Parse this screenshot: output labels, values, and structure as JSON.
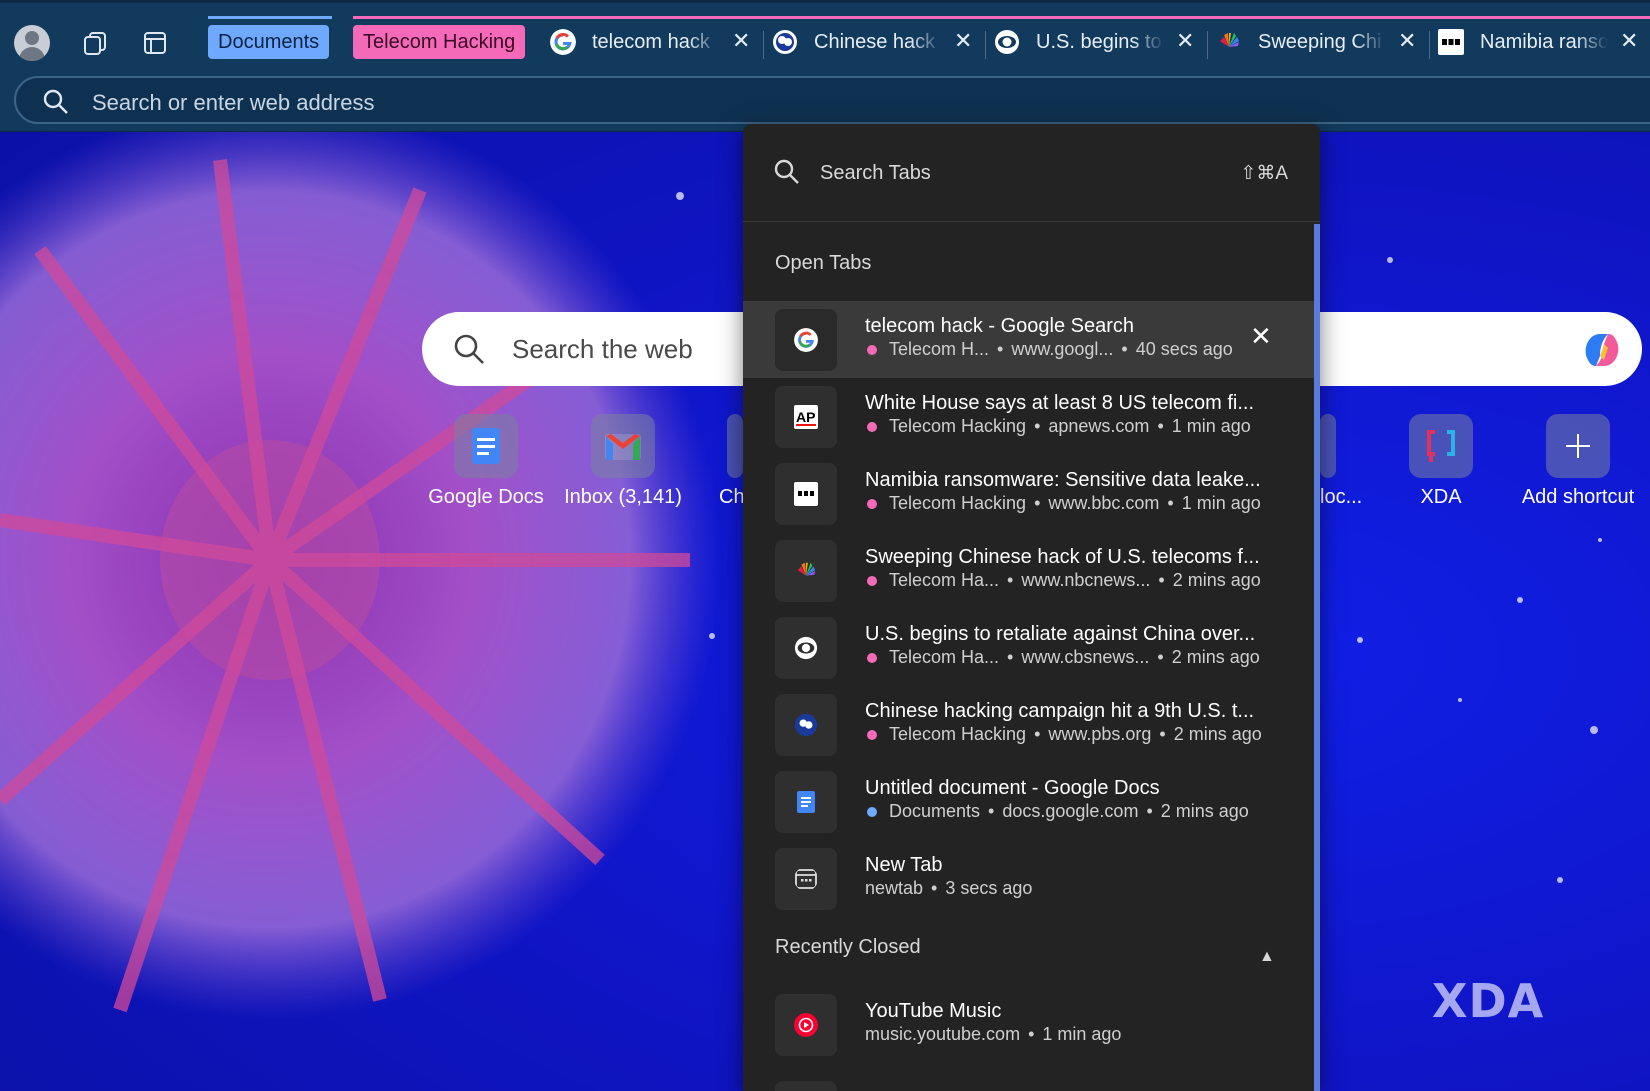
{
  "colors": {
    "tabstrip": "#123a5c",
    "docs_group": "#6ea8ff",
    "telecom_group": "#f46ab8",
    "popup_bg": "#232323",
    "desktop_bg": "#1420b8"
  },
  "tab_groups": [
    {
      "label": "Documents",
      "color": "#6ea8ff"
    },
    {
      "label": "Telecom Hacking",
      "color": "#f46ab8"
    }
  ],
  "tabs": [
    {
      "title": "telecom hack",
      "icon": "google-icon"
    },
    {
      "title": "Chinese hack",
      "icon": "pbs-icon"
    },
    {
      "title": "U.S. begins to",
      "icon": "cbs-icon"
    },
    {
      "title": "Sweeping Chi",
      "icon": "nbc-icon"
    },
    {
      "title": "Namibia ranso",
      "icon": "bbc-icon"
    }
  ],
  "addressbar": {
    "placeholder": "Search or enter web address"
  },
  "newtab": {
    "search_placeholder": "Search the web",
    "shortcuts": [
      {
        "label": "Google Docs",
        "icon": "google-docs-icon"
      },
      {
        "label": "Inbox (3,141)",
        "icon": "gmail-icon"
      },
      {
        "label": "Ch",
        "icon": "partial-shortcut-icon"
      },
      {
        "label": "loc...",
        "icon": "partial-shortcut-icon"
      },
      {
        "label": "XDA",
        "icon": "xda-icon"
      },
      {
        "label": "Add shortcut",
        "icon": "plus-icon"
      }
    ],
    "watermark": "XDA"
  },
  "tab_search": {
    "placeholder": "Search Tabs",
    "shortcut": "⇧⌘A",
    "open_tabs_label": "Open Tabs",
    "recently_closed_label": "Recently Closed",
    "open_tabs": [
      {
        "title": "telecom hack - Google Search",
        "group": "Telecom H...",
        "url": "www.googl...",
        "time": "40 secs ago",
        "icon": "google-icon",
        "dot": "pink"
      },
      {
        "title": "White House says at least 8 US telecom fi...",
        "group": "Telecom Hacking",
        "url": "apnews.com",
        "time": "1 min ago",
        "icon": "ap-icon",
        "dot": "pink"
      },
      {
        "title": "Namibia ransomware: Sensitive data leake...",
        "group": "Telecom Hacking",
        "url": "www.bbc.com",
        "time": "1 min ago",
        "icon": "bbc-icon",
        "dot": "pink"
      },
      {
        "title": "Sweeping Chinese hack of U.S. telecoms f...",
        "group": "Telecom Ha...",
        "url": "www.nbcnews...",
        "time": "2 mins ago",
        "icon": "nbc-icon",
        "dot": "pink"
      },
      {
        "title": "U.S. begins to retaliate against China over...",
        "group": "Telecom Ha...",
        "url": "www.cbsnews...",
        "time": "2 mins ago",
        "icon": "cbs-icon",
        "dot": "pink"
      },
      {
        "title": "Chinese hacking campaign hit a 9th U.S. t...",
        "group": "Telecom Hacking",
        "url": "www.pbs.org",
        "time": "2 mins ago",
        "icon": "pbs-icon",
        "dot": "pink"
      },
      {
        "title": "Untitled document - Google Docs",
        "group": "Documents",
        "url": "docs.google.com",
        "time": "2 mins ago",
        "icon": "google-docs-icon",
        "dot": "blue"
      },
      {
        "title": "New Tab",
        "group": "",
        "url": "newtab",
        "time": "3 secs ago",
        "icon": "newtab-icon",
        "dot": ""
      }
    ],
    "recently_closed": [
      {
        "title": "YouTube Music",
        "url": "music.youtube.com",
        "time": "1 min ago",
        "icon": "youtube-music-icon"
      }
    ]
  }
}
